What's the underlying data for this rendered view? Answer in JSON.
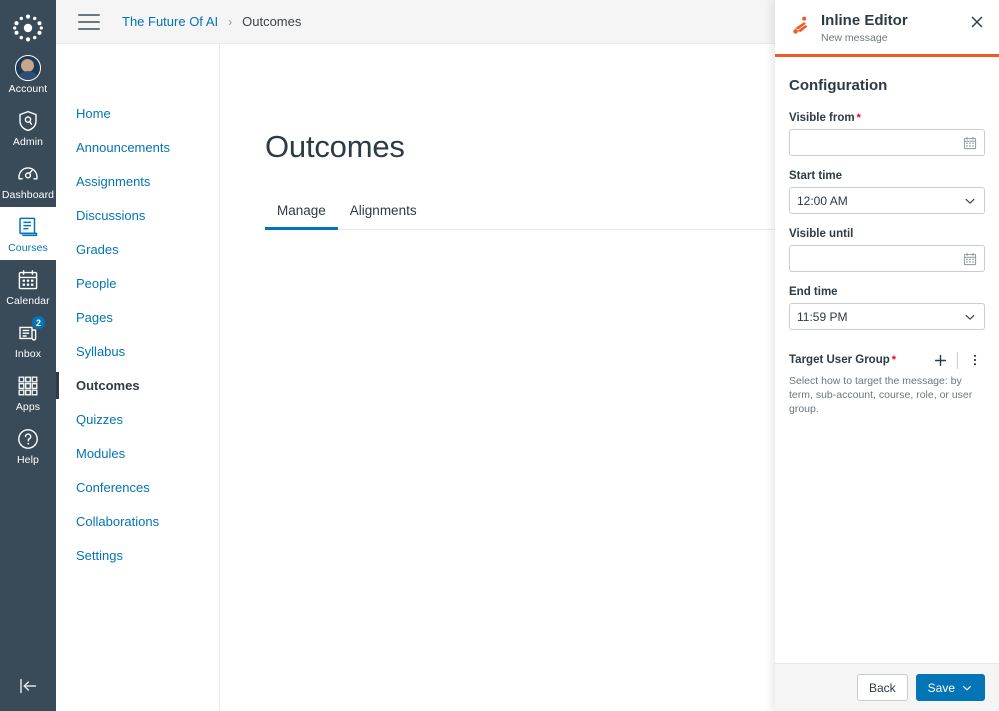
{
  "global_nav": {
    "logo": "canvas-logo-icon",
    "items": [
      {
        "label": "Account",
        "icon": "avatar-icon",
        "active": false,
        "badge": null
      },
      {
        "label": "Admin",
        "icon": "shield-icon",
        "active": false,
        "badge": null
      },
      {
        "label": "Dashboard",
        "icon": "dashboard-icon",
        "active": false,
        "badge": null
      },
      {
        "label": "Courses",
        "icon": "book-icon",
        "active": true,
        "badge": null
      },
      {
        "label": "Calendar",
        "icon": "calendar-icon",
        "active": false,
        "badge": null
      },
      {
        "label": "Inbox",
        "icon": "inbox-icon",
        "active": false,
        "badge": "2"
      },
      {
        "label": "Apps",
        "icon": "grid-apps-icon",
        "active": false,
        "badge": null
      },
      {
        "label": "Help",
        "icon": "question-circle-icon",
        "active": false,
        "badge": null
      }
    ],
    "collapse": {
      "icon": "collapse-left-icon"
    }
  },
  "breadcrumb": {
    "menu_icon": "hamburger-menu-icon",
    "course": "The Future Of AI",
    "separator": "›",
    "current": "Outcomes"
  },
  "course_nav": {
    "items": [
      {
        "label": "Home",
        "active": false
      },
      {
        "label": "Announcements",
        "active": false
      },
      {
        "label": "Assignments",
        "active": false
      },
      {
        "label": "Discussions",
        "active": false
      },
      {
        "label": "Grades",
        "active": false
      },
      {
        "label": "People",
        "active": false
      },
      {
        "label": "Pages",
        "active": false
      },
      {
        "label": "Syllabus",
        "active": false
      },
      {
        "label": "Outcomes",
        "active": true
      },
      {
        "label": "Quizzes",
        "active": false
      },
      {
        "label": "Modules",
        "active": false
      },
      {
        "label": "Conferences",
        "active": false
      },
      {
        "label": "Collaborations",
        "active": false
      },
      {
        "label": "Settings",
        "active": false
      }
    ]
  },
  "main": {
    "title": "Outcomes",
    "tabs": [
      {
        "label": "Manage",
        "active": true
      },
      {
        "label": "Alignments",
        "active": false
      }
    ]
  },
  "tray": {
    "logo": "inline-editor-logo-icon",
    "title": "Inline Editor",
    "subtitle": "New message",
    "close_icon": "close-icon",
    "accent_color": "#EF5B25",
    "section_title": "Configuration",
    "fields": [
      {
        "label": "Visible from",
        "required": true,
        "value": "",
        "type": "date",
        "icon": "calendar-icon"
      },
      {
        "label": "Start time",
        "required": false,
        "value": "12:00 AM",
        "type": "select",
        "icon": "chevron-down-icon"
      },
      {
        "label": "Visible until",
        "required": false,
        "value": "",
        "type": "date",
        "icon": "calendar-icon"
      },
      {
        "label": "End time",
        "required": false,
        "value": "11:59 PM",
        "type": "select",
        "icon": "chevron-down-icon"
      }
    ],
    "target_user_group": {
      "label": "Target User Group",
      "required": true,
      "add_icon": "plus-icon",
      "more_icon": "kebab-menu-icon",
      "description": "Select how to target the message: by term, sub-account, course, role, or user group."
    },
    "footer": {
      "back_label": "Back",
      "save_label": "Save",
      "save_caret_icon": "chevron-down-icon",
      "primary_color": "#0374B5"
    }
  }
}
